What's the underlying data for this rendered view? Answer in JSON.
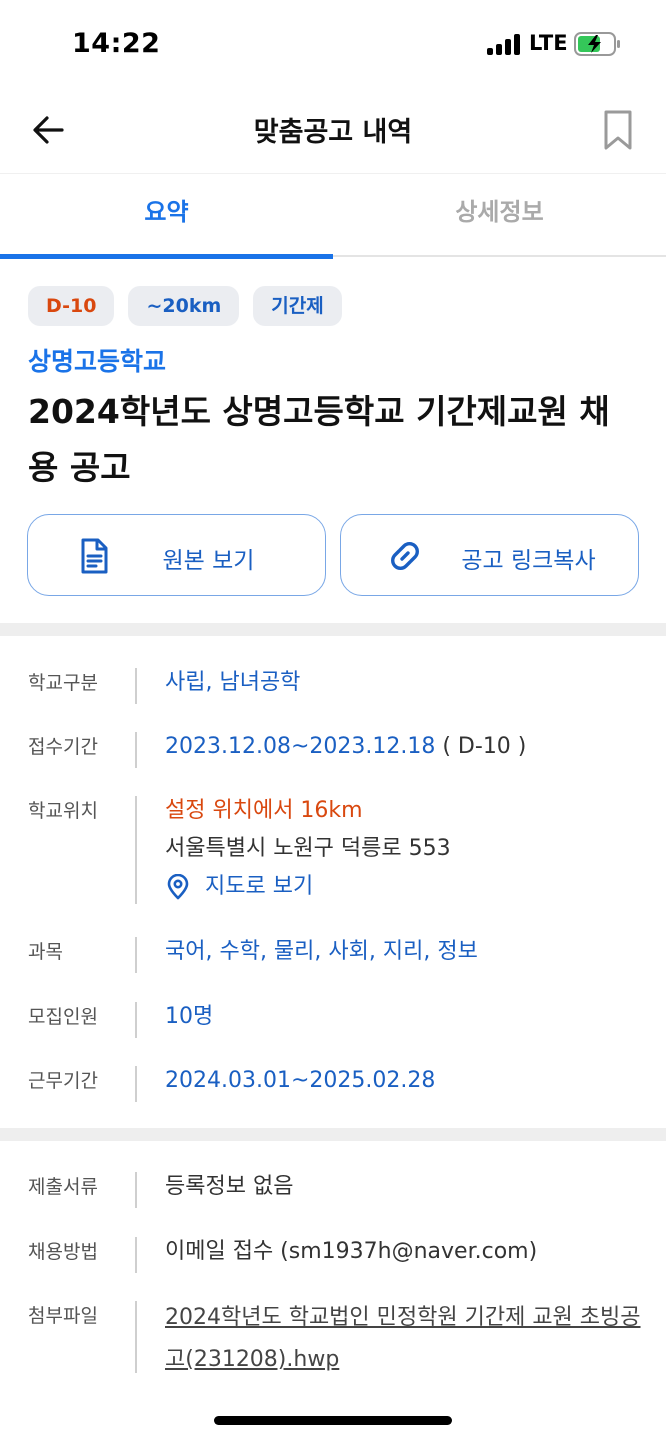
{
  "status_bar": {
    "time": "14:22",
    "network": "LTE"
  },
  "header": {
    "title": "맞춤공고 내역"
  },
  "tabs": [
    {
      "label": "요약",
      "active": true
    },
    {
      "label": "상세정보",
      "active": false
    }
  ],
  "badges": {
    "deadline": "D-10",
    "distance": "~20km",
    "type": "기간제"
  },
  "school_name": "상명고등학교",
  "post_title": "2024학년도 상명고등학교 기간제교원 채용 공고",
  "actions": {
    "original": "원본 보기",
    "copy_link": "공고 링크복사"
  },
  "info": {
    "school_type": {
      "label": "학교구분",
      "value": "사립, 남녀공학"
    },
    "application_period": {
      "label": "접수기간",
      "value": "2023.12.08~2023.12.18",
      "suffix": "( D-10 )"
    },
    "location": {
      "label": "학교위치",
      "distance": "설정 위치에서 16km",
      "address": "서울특별시 노원구 덕릉로 553",
      "map_link": "지도로 보기"
    },
    "subjects": {
      "label": "과목",
      "value": "국어, 수학, 물리, 사회, 지리, 정보"
    },
    "recruits": {
      "label": "모집인원",
      "value": "10명"
    },
    "work_period": {
      "label": "근무기간",
      "value": "2024.03.01~2025.02.28"
    }
  },
  "info2": {
    "documents": {
      "label": "제출서류",
      "value": "등록정보 없음"
    },
    "method": {
      "label": "채용방법",
      "value": "이메일 접수 (sm1937h@naver.com)"
    },
    "attachment": {
      "label": "첨부파일",
      "value": "2024학년도 학교법인 민정학원 기간제 교원 초빙공고(231208).hwp"
    }
  },
  "colors": {
    "accent": "#1a73e8",
    "link": "#1a5fc2",
    "warning": "#d9480f",
    "battery": "#34c759"
  }
}
